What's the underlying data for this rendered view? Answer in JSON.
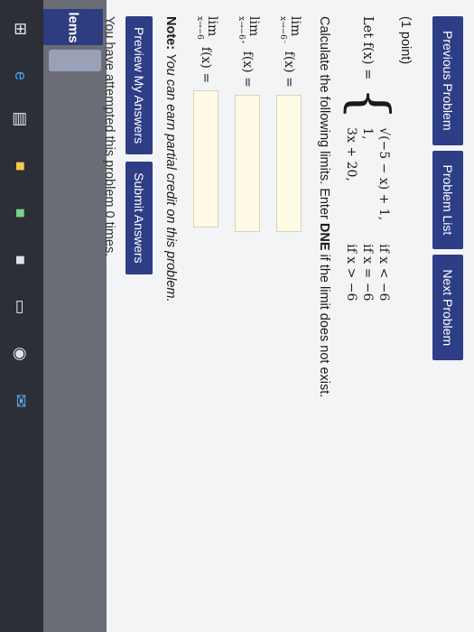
{
  "sidebar": {
    "active_label": "lems"
  },
  "taskbar": {
    "icons": [
      "windows-icon",
      "edge-icon",
      "folder-icon",
      "store-icon",
      "chrome-icon",
      "mail-icon",
      "app-icon"
    ]
  },
  "nav": {
    "previous": "Previous Problem",
    "list": "Problem List",
    "next": "Next Problem"
  },
  "problem": {
    "points": "(1 point)",
    "let_label": "Let f(x) =",
    "cases": [
      {
        "expr": "√(−5 − x) + 1,",
        "cond": "if x < −6"
      },
      {
        "expr": "1,",
        "cond": "if x = −6"
      },
      {
        "expr": "3x + 20,",
        "cond": "if x > −6"
      }
    ],
    "instruction_pre": "Calculate the following limits. Enter ",
    "instruction_dne": "DNE",
    "instruction_post": " if the limit does not exist.",
    "limits": [
      {
        "lim": "lim",
        "sub": "x→−6⁻",
        "fx": "f(x) ="
      },
      {
        "lim": "lim",
        "sub": "x→−6⁺",
        "fx": "f(x) ="
      },
      {
        "lim": "lim",
        "sub": "x→−6",
        "fx": "f(x) ="
      }
    ],
    "note_bold": "Note:",
    "note_text": " You can earn partial credit on this problem."
  },
  "actions": {
    "preview": "Preview My Answers",
    "submit": "Submit Answers"
  },
  "attempts_text": "You have attempted this problem 0 times."
}
